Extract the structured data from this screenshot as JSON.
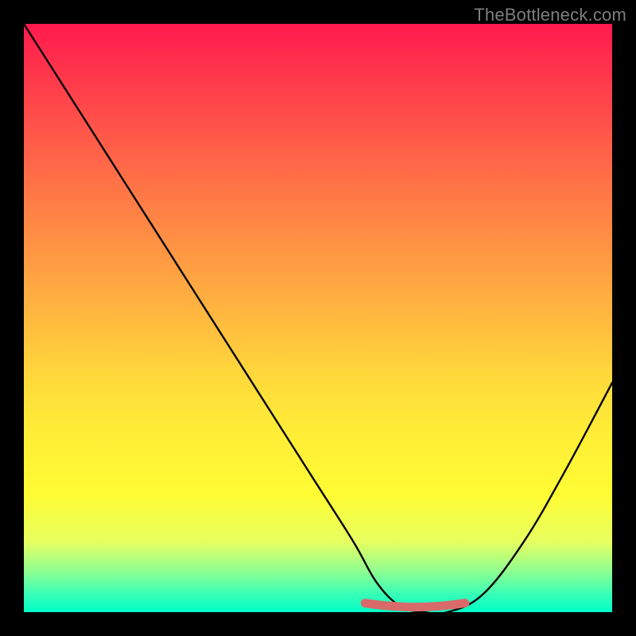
{
  "attribution": "TheBottleneck.com",
  "chart_data": {
    "type": "line",
    "title": "",
    "xlabel": "",
    "ylabel": "",
    "xlim": [
      0,
      100
    ],
    "ylim": [
      0,
      100
    ],
    "series": [
      {
        "name": "bottleneck-curve",
        "color": "#000000",
        "x": [
          0,
          7,
          14,
          21,
          28,
          35,
          42,
          49,
          56,
          60,
          64,
          68,
          72,
          78,
          85,
          92,
          100
        ],
        "y": [
          100,
          89,
          78,
          67,
          56,
          45,
          34,
          23,
          12,
          5,
          1,
          0,
          0,
          3,
          12,
          24,
          39
        ]
      },
      {
        "name": "optimal-range-marker",
        "color": "#d96a6a",
        "x": [
          58,
          75
        ],
        "y": [
          1,
          1
        ]
      }
    ]
  },
  "layout": {
    "image_size": 800,
    "plot_inset": 30,
    "plot_size": 740
  },
  "colors": {
    "background": "#000000",
    "gradient_top": "#ff1a4d",
    "gradient_bottom": "#00ffc8",
    "curve": "#000000",
    "marker": "#d96a6a",
    "attribution_text": "#7e7e7e"
  }
}
